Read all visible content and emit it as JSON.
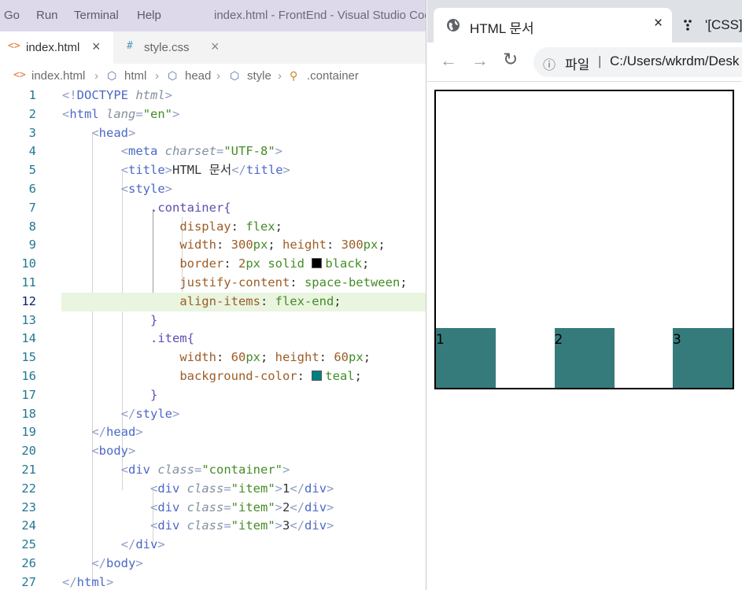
{
  "vscode": {
    "menu": [
      "Go",
      "Run",
      "Terminal",
      "Help"
    ],
    "window_title": "index.html - FrontEnd - Visual Studio Code",
    "tabs": [
      {
        "icon": "<>",
        "label": "index.html",
        "close": "×"
      },
      {
        "icon": "#",
        "label": "style.css",
        "close": "×"
      }
    ],
    "breadcrumb": [
      "index.html",
      "html",
      "head",
      "style",
      ".container"
    ],
    "current_line": 12,
    "colors": {
      "teal": "#008080",
      "black": "#000000",
      "line_highlight": "#e9f5df"
    },
    "code_lines": [
      {
        "n": "1",
        "segs": [
          [
            "punc",
            "<!"
          ],
          [
            "tag",
            "DOCTYPE "
          ],
          [
            "attr",
            "html"
          ],
          [
            "punc",
            ">"
          ]
        ]
      },
      {
        "n": "2",
        "segs": [
          [
            "punc",
            "<"
          ],
          [
            "tag",
            "html "
          ],
          [
            "attr",
            "lang"
          ],
          [
            "punc",
            "="
          ],
          [
            "str",
            "\"en\""
          ],
          [
            "punc",
            ">"
          ]
        ]
      },
      {
        "n": "3",
        "segs": [
          [
            "plain",
            "    "
          ],
          [
            "punc",
            "<"
          ],
          [
            "tag",
            "head"
          ],
          [
            "punc",
            ">"
          ]
        ]
      },
      {
        "n": "4",
        "segs": [
          [
            "plain",
            "        "
          ],
          [
            "punc",
            "<"
          ],
          [
            "tag",
            "meta "
          ],
          [
            "attr",
            "charset"
          ],
          [
            "punc",
            "="
          ],
          [
            "str",
            "\"UTF-8\""
          ],
          [
            "punc",
            ">"
          ]
        ]
      },
      {
        "n": "5",
        "segs": [
          [
            "plain",
            "        "
          ],
          [
            "punc",
            "<"
          ],
          [
            "tag",
            "title"
          ],
          [
            "punc",
            ">"
          ],
          [
            "plain",
            "HTML 문서"
          ],
          [
            "punc",
            "</"
          ],
          [
            "tag",
            "title"
          ],
          [
            "punc",
            ">"
          ]
        ]
      },
      {
        "n": "6",
        "segs": [
          [
            "plain",
            "        "
          ],
          [
            "punc",
            "<"
          ],
          [
            "tag",
            "style"
          ],
          [
            "punc",
            ">"
          ]
        ]
      },
      {
        "n": "7",
        "segs": [
          [
            "plain",
            "            "
          ],
          [
            "sel",
            ".container{"
          ]
        ]
      },
      {
        "n": "8",
        "segs": [
          [
            "plain",
            "                "
          ],
          [
            "prop",
            "display"
          ],
          [
            "plain",
            ": "
          ],
          [
            "val",
            "flex"
          ],
          [
            "plain",
            ";"
          ]
        ]
      },
      {
        "n": "9",
        "segs": [
          [
            "plain",
            "                "
          ],
          [
            "prop",
            "width"
          ],
          [
            "plain",
            ": "
          ],
          [
            "num",
            "300"
          ],
          [
            "val",
            "px"
          ],
          [
            "plain",
            "; "
          ],
          [
            "prop",
            "height"
          ],
          [
            "plain",
            ": "
          ],
          [
            "num",
            "300"
          ],
          [
            "val",
            "px"
          ],
          [
            "plain",
            ";"
          ]
        ]
      },
      {
        "n": "10",
        "segs": [
          [
            "plain",
            "                "
          ],
          [
            "prop",
            "border"
          ],
          [
            "plain",
            ": "
          ],
          [
            "num",
            "2"
          ],
          [
            "val",
            "px solid "
          ],
          [
            "swatch",
            "#000000"
          ],
          [
            "val",
            "black"
          ],
          [
            "plain",
            ";"
          ]
        ]
      },
      {
        "n": "11",
        "segs": [
          [
            "plain",
            "                "
          ],
          [
            "prop",
            "justify-content"
          ],
          [
            "plain",
            ": "
          ],
          [
            "val",
            "space-between"
          ],
          [
            "plain",
            ";"
          ]
        ]
      },
      {
        "n": "12",
        "segs": [
          [
            "plain",
            "                "
          ],
          [
            "prop",
            "align-items"
          ],
          [
            "plain",
            ": "
          ],
          [
            "val",
            "flex-end"
          ],
          [
            "plain",
            ";"
          ]
        ]
      },
      {
        "n": "13",
        "segs": [
          [
            "plain",
            "            "
          ],
          [
            "sel",
            "}"
          ]
        ]
      },
      {
        "n": "14",
        "segs": [
          [
            "plain",
            "            "
          ],
          [
            "sel",
            ".item{"
          ]
        ]
      },
      {
        "n": "15",
        "segs": [
          [
            "plain",
            "                "
          ],
          [
            "prop",
            "width"
          ],
          [
            "plain",
            ": "
          ],
          [
            "num",
            "60"
          ],
          [
            "val",
            "px"
          ],
          [
            "plain",
            "; "
          ],
          [
            "prop",
            "height"
          ],
          [
            "plain",
            ": "
          ],
          [
            "num",
            "60"
          ],
          [
            "val",
            "px"
          ],
          [
            "plain",
            ";"
          ]
        ]
      },
      {
        "n": "16",
        "segs": [
          [
            "plain",
            "                "
          ],
          [
            "prop",
            "background-color"
          ],
          [
            "plain",
            ": "
          ],
          [
            "swatch",
            "#008080"
          ],
          [
            "val",
            "teal"
          ],
          [
            "plain",
            ";"
          ]
        ]
      },
      {
        "n": "17",
        "segs": [
          [
            "plain",
            "            "
          ],
          [
            "sel",
            "}"
          ]
        ]
      },
      {
        "n": "18",
        "segs": [
          [
            "plain",
            "        "
          ],
          [
            "punc",
            "</"
          ],
          [
            "tag",
            "style"
          ],
          [
            "punc",
            ">"
          ]
        ]
      },
      {
        "n": "19",
        "segs": [
          [
            "plain",
            "    "
          ],
          [
            "punc",
            "</"
          ],
          [
            "tag",
            "head"
          ],
          [
            "punc",
            ">"
          ]
        ]
      },
      {
        "n": "20",
        "segs": [
          [
            "plain",
            "    "
          ],
          [
            "punc",
            "<"
          ],
          [
            "tag",
            "body"
          ],
          [
            "punc",
            ">"
          ]
        ]
      },
      {
        "n": "21",
        "segs": [
          [
            "plain",
            "        "
          ],
          [
            "punc",
            "<"
          ],
          [
            "tag",
            "div "
          ],
          [
            "attr",
            "class"
          ],
          [
            "punc",
            "="
          ],
          [
            "str",
            "\"container\""
          ],
          [
            "punc",
            ">"
          ]
        ]
      },
      {
        "n": "22",
        "segs": [
          [
            "plain",
            "            "
          ],
          [
            "punc",
            "<"
          ],
          [
            "tag",
            "div "
          ],
          [
            "attr",
            "class"
          ],
          [
            "punc",
            "="
          ],
          [
            "str",
            "\"item\""
          ],
          [
            "punc",
            ">"
          ],
          [
            "plain",
            "1"
          ],
          [
            "punc",
            "</"
          ],
          [
            "tag",
            "div"
          ],
          [
            "punc",
            ">"
          ]
        ]
      },
      {
        "n": "23",
        "segs": [
          [
            "plain",
            "            "
          ],
          [
            "punc",
            "<"
          ],
          [
            "tag",
            "div "
          ],
          [
            "attr",
            "class"
          ],
          [
            "punc",
            "="
          ],
          [
            "str",
            "\"item\""
          ],
          [
            "punc",
            ">"
          ],
          [
            "plain",
            "2"
          ],
          [
            "punc",
            "</"
          ],
          [
            "tag",
            "div"
          ],
          [
            "punc",
            ">"
          ]
        ]
      },
      {
        "n": "24",
        "segs": [
          [
            "plain",
            "            "
          ],
          [
            "punc",
            "<"
          ],
          [
            "tag",
            "div "
          ],
          [
            "attr",
            "class"
          ],
          [
            "punc",
            "="
          ],
          [
            "str",
            "\"item\""
          ],
          [
            "punc",
            ">"
          ],
          [
            "plain",
            "3"
          ],
          [
            "punc",
            "</"
          ],
          [
            "tag",
            "div"
          ],
          [
            "punc",
            ">"
          ]
        ]
      },
      {
        "n": "25",
        "segs": [
          [
            "plain",
            "        "
          ],
          [
            "punc",
            "</"
          ],
          [
            "tag",
            "div"
          ],
          [
            "punc",
            ">"
          ]
        ]
      },
      {
        "n": "26",
        "segs": [
          [
            "plain",
            "    "
          ],
          [
            "punc",
            "</"
          ],
          [
            "tag",
            "body"
          ],
          [
            "punc",
            ">"
          ]
        ]
      },
      {
        "n": "27",
        "segs": [
          [
            "punc",
            "</"
          ],
          [
            "tag",
            "html"
          ],
          [
            "punc",
            ">"
          ]
        ]
      }
    ]
  },
  "browser": {
    "active_tab_title": "HTML 문서",
    "active_tab_close": "×",
    "second_tab_title": "'[CSS]",
    "nav": {
      "back": "←",
      "forward": "→",
      "reload": "↻"
    },
    "address": {
      "info": "ⓘ",
      "scheme_label": "파일",
      "separator": "|",
      "path": "C:/Users/wkrdm/Desk"
    },
    "demo": {
      "items": [
        "1",
        "2",
        "3"
      ],
      "item_color": "#367b7b",
      "border_color": "#000000"
    }
  }
}
